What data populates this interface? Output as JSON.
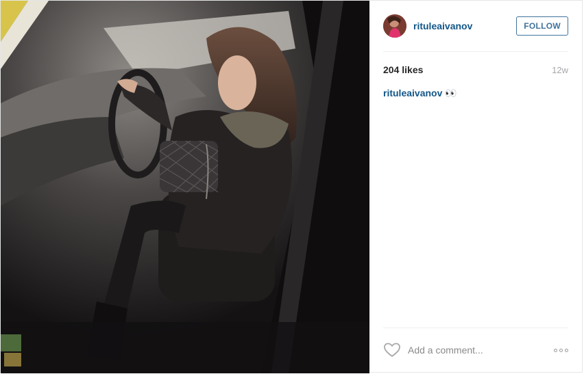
{
  "post": {
    "photo_alt": "Photo by rituleaivanov",
    "user": {
      "username": "rituleaivanov",
      "follow_label": "FOLLOW"
    },
    "stats": {
      "likes": "204 likes",
      "age": "12w"
    },
    "caption": {
      "username": "rituleaivanov",
      "text": "👀"
    },
    "comment": {
      "placeholder": "Add a comment..."
    }
  },
  "colors": {
    "username": "#125688",
    "follow_button": "#3f729b",
    "muted_text": "#a5a7aa",
    "border": "#efefef"
  },
  "icons": [
    "heart-icon",
    "more-options-icon"
  ]
}
